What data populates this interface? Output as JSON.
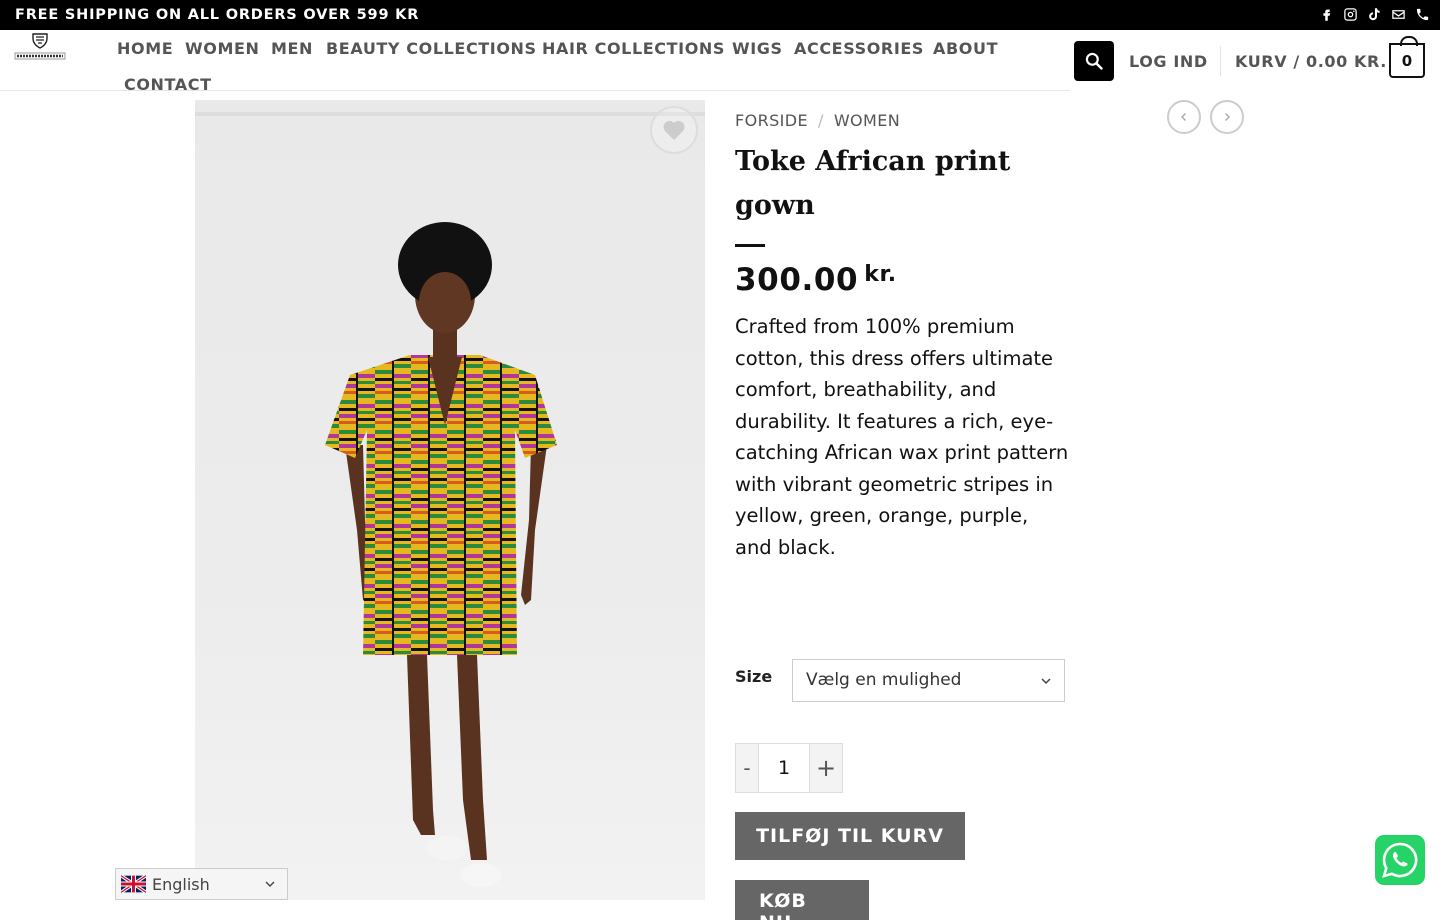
{
  "topbar": {
    "promo": "FREE SHIPPING ON ALL ORDERS OVER 599 KR",
    "social_icons": [
      "facebook-icon",
      "instagram-icon",
      "tiktok-icon",
      "email-icon",
      "phone-icon"
    ]
  },
  "header": {
    "logo_text": "BUTIKKANAMA",
    "nav": [
      "HOME",
      "WOMEN",
      "MEN",
      "BEAUTY COLLECTIONS",
      "HAIR COLLECTIONS",
      "WIGS",
      "ACCESSORIES",
      "ABOUT",
      "CONTACT"
    ],
    "login": "LOG IND",
    "cart_label": "KURV / 0.00 KR.",
    "cart_count": "0"
  },
  "breadcrumb": {
    "home": "FORSIDE",
    "separator": "/",
    "category": "WOMEN"
  },
  "product": {
    "title": "Toke African print gown",
    "price": "300.00",
    "currency": "kr.",
    "description": "Crafted from 100% premium cotton, this dress offers ultimate comfort, breathability, and durability. It features a rich, eye-catching African wax print pattern with vibrant geometric stripes in yellow, green, orange, purple, and black.",
    "size_label": "Size",
    "size_selected": "Vælg en mulighed",
    "qty_minus": "-",
    "qty_value": "1",
    "qty_plus": "+",
    "add_to_cart": "TILFØJ TIL KURV",
    "buy_now": "KØB NU"
  },
  "language": {
    "current": "English"
  },
  "colors": {
    "accent_dark": "#000000",
    "button_gray": "#666666",
    "whatsapp_green": "#25d366"
  }
}
